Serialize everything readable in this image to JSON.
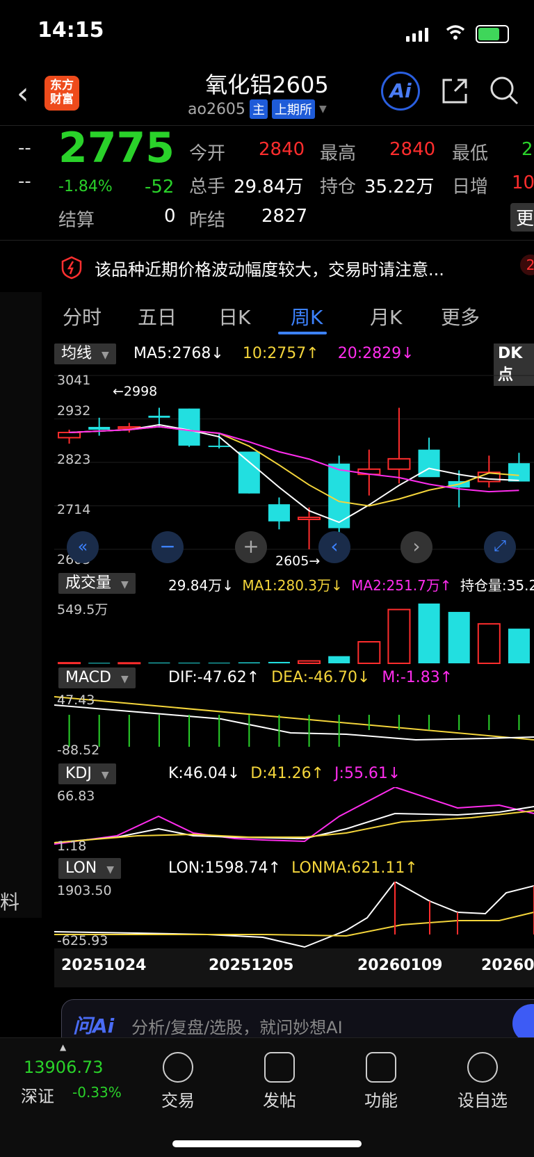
{
  "status": {
    "time": "14:15"
  },
  "header": {
    "back_icon": "chevron-left-icon",
    "logo_text": "东方财富",
    "title": "氧化铝2605",
    "contract": "ao2605",
    "tag_main": "主",
    "tag_exchange": "上期所",
    "ai_label": "Ai"
  },
  "quote": {
    "left_dash1": "--",
    "left_dash2": "--",
    "price": "2775",
    "pct": "-1.84%",
    "change": "-52",
    "settle_label": "结算",
    "settle": "0",
    "prev_settle_label": "昨结",
    "prev_settle": "2827",
    "open_label": "今开",
    "open": "2840",
    "high_label": "最高",
    "high": "2840",
    "low_label": "最低",
    "low": "2",
    "volume_label": "总手",
    "volume": "29.84万",
    "oi_label": "持仓",
    "oi": "35.22万",
    "daily_inc_label": "日增",
    "daily_inc": "10",
    "more_label": "更"
  },
  "notice": {
    "text": "该品种近期价格波动幅度较大，交易时请注意...",
    "badge": "2"
  },
  "tabs": [
    "分时",
    "五日",
    "日K",
    "周K",
    "月K",
    "更多"
  ],
  "active_tab": "周K",
  "main_chart": {
    "indicator": "均线",
    "ma5": "MA5:2768↓",
    "ma10": "10:2757↑",
    "ma20": "20:2829↓",
    "dk": "DK点",
    "y_labels": [
      "3041",
      "2932",
      "2823",
      "2714",
      "2605"
    ],
    "high_marker": "←2998",
    "low_marker": "2605→"
  },
  "volume": {
    "indicator": "成交量",
    "vol": "29.84万↓",
    "ma1": "MA1:280.3万↓",
    "ma2": "MA2:251.7万↑",
    "oi": "持仓量:35.22",
    "y_top": "549.5万"
  },
  "macd": {
    "indicator": "MACD",
    "dif": "DIF:-47.62↑",
    "dea": "DEA:-46.70↓",
    "m": "M:-1.83↑",
    "y_top": "47.43",
    "y_bottom": "-88.52"
  },
  "kdj": {
    "indicator": "KDJ",
    "k": "K:46.04↓",
    "d": "D:41.26↑",
    "j": "J:55.61↓",
    "y_top": "66.83",
    "y_bottom": "1.18"
  },
  "lon": {
    "indicator": "LON",
    "lon": "LON:1598.74↑",
    "lonma": "LONMA:621.11↑",
    "y_top": "1903.50",
    "y_bottom": "-625.93"
  },
  "x_dates": [
    "20251024",
    "20251205",
    "20260109",
    "20260"
  ],
  "side_label": "料",
  "ai_bar": {
    "logo": "问Ai",
    "placeholder": "分析/复盘/选股，就问妙想AI"
  },
  "bottom": {
    "index_value": "13906.73",
    "index_name": "深证",
    "index_pct": "-0.33%",
    "nav": [
      "交易",
      "发帖",
      "功能",
      "设自选"
    ]
  },
  "colors": {
    "up": "#ff2d2d",
    "down": "#2ad22a",
    "bear_candle": "#22dfe0",
    "ma5": "#ffffff",
    "ma10": "#f4d53b",
    "ma20": "#ff2dee",
    "accent": "#3d82ff"
  },
  "chart_data": {
    "type": "candlestick",
    "x": [
      "w1",
      "w2",
      "w3",
      "w4",
      "w5",
      "w6",
      "w7",
      "w8",
      "w9",
      "w10",
      "w11",
      "w12",
      "w13",
      "w14",
      "w15",
      "w16"
    ],
    "ohlc": [
      [
        2885,
        2905,
        2870,
        2898
      ],
      [
        2912,
        2935,
        2890,
        2905
      ],
      [
        2908,
        2922,
        2898,
        2912
      ],
      [
        2940,
        2960,
        2910,
        2935
      ],
      [
        2958,
        2958,
        2862,
        2865
      ],
      [
        2865,
        2895,
        2858,
        2862
      ],
      [
        2850,
        2850,
        2745,
        2745
      ],
      [
        2718,
        2735,
        2655,
        2675
      ],
      [
        2680,
        2710,
        2605,
        2685
      ],
      [
        2820,
        2840,
        2615,
        2658
      ],
      [
        2793,
        2855,
        2740,
        2806
      ],
      [
        2806,
        2960,
        2770,
        2832
      ],
      [
        2855,
        2885,
        2790,
        2786
      ],
      [
        2776,
        2803,
        2710,
        2760
      ],
      [
        2775,
        2840,
        2760,
        2798
      ],
      [
        2821,
        2847,
        2790,
        2775
      ]
    ],
    "volume_wan": [
      5,
      4,
      4,
      6,
      5,
      5,
      8,
      12,
      20,
      60,
      180,
      450,
      500,
      430,
      330,
      290
    ],
    "ylim": [
      2605,
      3041
    ]
  }
}
